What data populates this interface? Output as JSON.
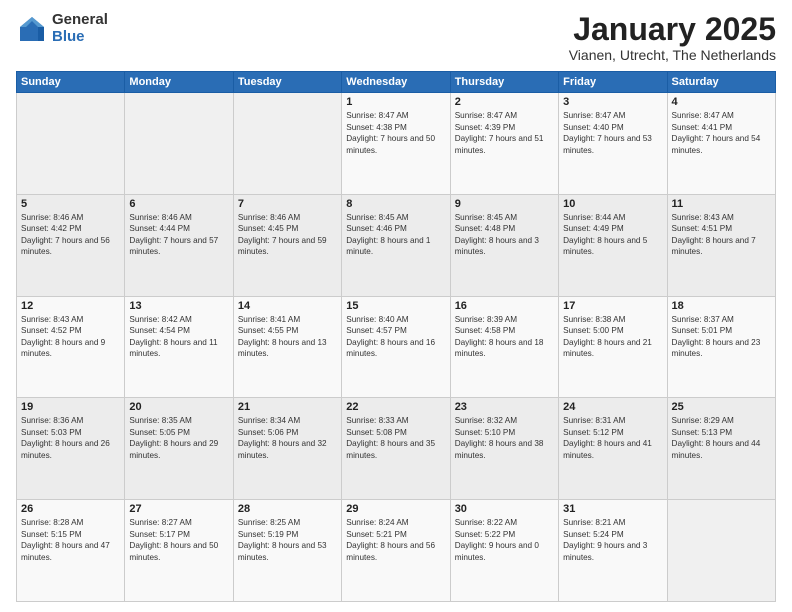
{
  "logo": {
    "general": "General",
    "blue": "Blue"
  },
  "header": {
    "month": "January 2025",
    "location": "Vianen, Utrecht, The Netherlands"
  },
  "weekdays": [
    "Sunday",
    "Monday",
    "Tuesday",
    "Wednesday",
    "Thursday",
    "Friday",
    "Saturday"
  ],
  "weeks": [
    [
      {
        "day": "",
        "sunrise": "",
        "sunset": "",
        "daylight": ""
      },
      {
        "day": "",
        "sunrise": "",
        "sunset": "",
        "daylight": ""
      },
      {
        "day": "",
        "sunrise": "",
        "sunset": "",
        "daylight": ""
      },
      {
        "day": "1",
        "sunrise": "Sunrise: 8:47 AM",
        "sunset": "Sunset: 4:38 PM",
        "daylight": "Daylight: 7 hours and 50 minutes."
      },
      {
        "day": "2",
        "sunrise": "Sunrise: 8:47 AM",
        "sunset": "Sunset: 4:39 PM",
        "daylight": "Daylight: 7 hours and 51 minutes."
      },
      {
        "day": "3",
        "sunrise": "Sunrise: 8:47 AM",
        "sunset": "Sunset: 4:40 PM",
        "daylight": "Daylight: 7 hours and 53 minutes."
      },
      {
        "day": "4",
        "sunrise": "Sunrise: 8:47 AM",
        "sunset": "Sunset: 4:41 PM",
        "daylight": "Daylight: 7 hours and 54 minutes."
      }
    ],
    [
      {
        "day": "5",
        "sunrise": "Sunrise: 8:46 AM",
        "sunset": "Sunset: 4:42 PM",
        "daylight": "Daylight: 7 hours and 56 minutes."
      },
      {
        "day": "6",
        "sunrise": "Sunrise: 8:46 AM",
        "sunset": "Sunset: 4:44 PM",
        "daylight": "Daylight: 7 hours and 57 minutes."
      },
      {
        "day": "7",
        "sunrise": "Sunrise: 8:46 AM",
        "sunset": "Sunset: 4:45 PM",
        "daylight": "Daylight: 7 hours and 59 minutes."
      },
      {
        "day": "8",
        "sunrise": "Sunrise: 8:45 AM",
        "sunset": "Sunset: 4:46 PM",
        "daylight": "Daylight: 8 hours and 1 minute."
      },
      {
        "day": "9",
        "sunrise": "Sunrise: 8:45 AM",
        "sunset": "Sunset: 4:48 PM",
        "daylight": "Daylight: 8 hours and 3 minutes."
      },
      {
        "day": "10",
        "sunrise": "Sunrise: 8:44 AM",
        "sunset": "Sunset: 4:49 PM",
        "daylight": "Daylight: 8 hours and 5 minutes."
      },
      {
        "day": "11",
        "sunrise": "Sunrise: 8:43 AM",
        "sunset": "Sunset: 4:51 PM",
        "daylight": "Daylight: 8 hours and 7 minutes."
      }
    ],
    [
      {
        "day": "12",
        "sunrise": "Sunrise: 8:43 AM",
        "sunset": "Sunset: 4:52 PM",
        "daylight": "Daylight: 8 hours and 9 minutes."
      },
      {
        "day": "13",
        "sunrise": "Sunrise: 8:42 AM",
        "sunset": "Sunset: 4:54 PM",
        "daylight": "Daylight: 8 hours and 11 minutes."
      },
      {
        "day": "14",
        "sunrise": "Sunrise: 8:41 AM",
        "sunset": "Sunset: 4:55 PM",
        "daylight": "Daylight: 8 hours and 13 minutes."
      },
      {
        "day": "15",
        "sunrise": "Sunrise: 8:40 AM",
        "sunset": "Sunset: 4:57 PM",
        "daylight": "Daylight: 8 hours and 16 minutes."
      },
      {
        "day": "16",
        "sunrise": "Sunrise: 8:39 AM",
        "sunset": "Sunset: 4:58 PM",
        "daylight": "Daylight: 8 hours and 18 minutes."
      },
      {
        "day": "17",
        "sunrise": "Sunrise: 8:38 AM",
        "sunset": "Sunset: 5:00 PM",
        "daylight": "Daylight: 8 hours and 21 minutes."
      },
      {
        "day": "18",
        "sunrise": "Sunrise: 8:37 AM",
        "sunset": "Sunset: 5:01 PM",
        "daylight": "Daylight: 8 hours and 23 minutes."
      }
    ],
    [
      {
        "day": "19",
        "sunrise": "Sunrise: 8:36 AM",
        "sunset": "Sunset: 5:03 PM",
        "daylight": "Daylight: 8 hours and 26 minutes."
      },
      {
        "day": "20",
        "sunrise": "Sunrise: 8:35 AM",
        "sunset": "Sunset: 5:05 PM",
        "daylight": "Daylight: 8 hours and 29 minutes."
      },
      {
        "day": "21",
        "sunrise": "Sunrise: 8:34 AM",
        "sunset": "Sunset: 5:06 PM",
        "daylight": "Daylight: 8 hours and 32 minutes."
      },
      {
        "day": "22",
        "sunrise": "Sunrise: 8:33 AM",
        "sunset": "Sunset: 5:08 PM",
        "daylight": "Daylight: 8 hours and 35 minutes."
      },
      {
        "day": "23",
        "sunrise": "Sunrise: 8:32 AM",
        "sunset": "Sunset: 5:10 PM",
        "daylight": "Daylight: 8 hours and 38 minutes."
      },
      {
        "day": "24",
        "sunrise": "Sunrise: 8:31 AM",
        "sunset": "Sunset: 5:12 PM",
        "daylight": "Daylight: 8 hours and 41 minutes."
      },
      {
        "day": "25",
        "sunrise": "Sunrise: 8:29 AM",
        "sunset": "Sunset: 5:13 PM",
        "daylight": "Daylight: 8 hours and 44 minutes."
      }
    ],
    [
      {
        "day": "26",
        "sunrise": "Sunrise: 8:28 AM",
        "sunset": "Sunset: 5:15 PM",
        "daylight": "Daylight: 8 hours and 47 minutes."
      },
      {
        "day": "27",
        "sunrise": "Sunrise: 8:27 AM",
        "sunset": "Sunset: 5:17 PM",
        "daylight": "Daylight: 8 hours and 50 minutes."
      },
      {
        "day": "28",
        "sunrise": "Sunrise: 8:25 AM",
        "sunset": "Sunset: 5:19 PM",
        "daylight": "Daylight: 8 hours and 53 minutes."
      },
      {
        "day": "29",
        "sunrise": "Sunrise: 8:24 AM",
        "sunset": "Sunset: 5:21 PM",
        "daylight": "Daylight: 8 hours and 56 minutes."
      },
      {
        "day": "30",
        "sunrise": "Sunrise: 8:22 AM",
        "sunset": "Sunset: 5:22 PM",
        "daylight": "Daylight: 9 hours and 0 minutes."
      },
      {
        "day": "31",
        "sunrise": "Sunrise: 8:21 AM",
        "sunset": "Sunset: 5:24 PM",
        "daylight": "Daylight: 9 hours and 3 minutes."
      },
      {
        "day": "",
        "sunrise": "",
        "sunset": "",
        "daylight": ""
      }
    ]
  ]
}
